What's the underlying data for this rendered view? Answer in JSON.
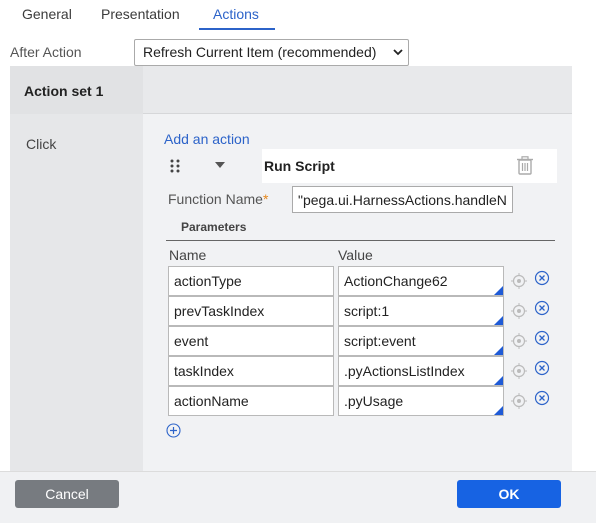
{
  "tabs": [
    {
      "label": "General"
    },
    {
      "label": "Presentation"
    },
    {
      "label": "Actions",
      "active": true
    }
  ],
  "after_action": {
    "label": "After Action",
    "selected": "Refresh Current Item (recommended)"
  },
  "action_set": {
    "title": "Action set 1",
    "event": "Click",
    "add_action_label": "Add an action",
    "action": {
      "name": "Run Script",
      "function_name_label": "Function Name",
      "required_marker": "*",
      "function_name_value": "\"pega.ui.HarnessActions.handleN"
    },
    "parameters": {
      "label": "Parameters",
      "columns": {
        "name": "Name",
        "value": "Value"
      },
      "rows": [
        {
          "name": "actionType",
          "value": "ActionChange62"
        },
        {
          "name": "prevTaskIndex",
          "value": "script:1"
        },
        {
          "name": "event",
          "value": "script:event"
        },
        {
          "name": "taskIndex",
          "value": ".pyActionsListIndex"
        },
        {
          "name": "actionName",
          "value": ".pyUsage"
        }
      ]
    }
  },
  "buttons": {
    "cancel": "Cancel",
    "ok": "OK"
  },
  "colors": {
    "accent": "#2c63c9",
    "ok": "#1763e3",
    "cancel": "#777b80",
    "required": "#e5861a"
  }
}
